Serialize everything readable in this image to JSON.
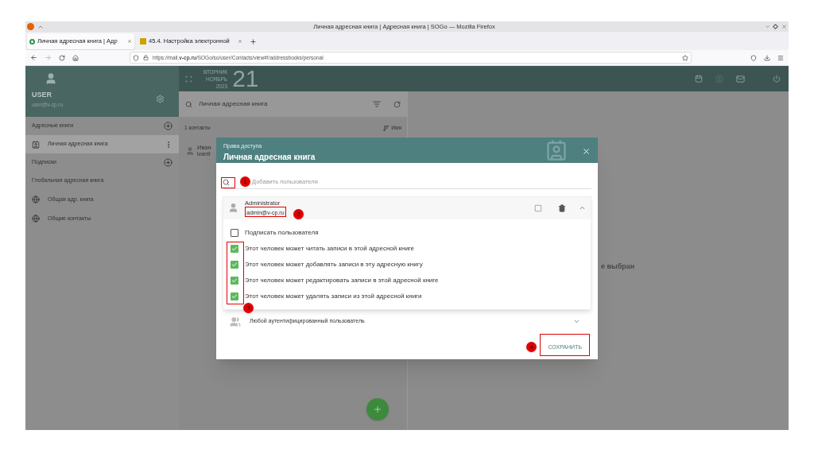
{
  "browser": {
    "title": "Личная адресная книга | Адресная книга | SOGo — Mozilla Firefox",
    "tabs": [
      {
        "label": "Личная адресная книга | Адр",
        "selected": true
      },
      {
        "label": "45.4. Настройка электронной",
        "selected": false
      }
    ],
    "url": "https://mail.**v-cp.ru**/SOGo/so/user/Contacts/view#!/addressbooks/personal"
  },
  "user": {
    "name": "USER",
    "email": "user@v-cp.ru"
  },
  "date": {
    "weekday": "ВТОРНИК",
    "month": "НОЯБРЬ",
    "year": "2023",
    "day": "21"
  },
  "sidebar": [
    {
      "kind": "header",
      "label": "Адресные книги",
      "addable": true
    },
    {
      "kind": "book",
      "label": "Личная адресная книга",
      "selected": true
    },
    {
      "kind": "header",
      "label": "Подписки",
      "addable": true
    },
    {
      "kind": "header",
      "label": "Глобальная адресная книга",
      "addable": false
    },
    {
      "kind": "global",
      "label": "Общая адр. книга",
      "selected": false
    },
    {
      "kind": "global",
      "label": "Общие контакты",
      "selected": false
    }
  ],
  "list": {
    "title": "Личная адресная книга",
    "count": "1 контакты",
    "sort": "Имя",
    "contacts": [
      {
        "name": "Иван",
        "email": "ivan9"
      }
    ]
  },
  "empty_text": "е выбран",
  "dialog": {
    "subtitle": "Права доступа",
    "title": "Личная адресная книга",
    "search_placeholder": "Добавить пользователя",
    "users": [
      {
        "name": "Administrator",
        "email": "admin@v-cp.ru",
        "expanded": true,
        "permissions": [
          {
            "label": "Подписать пользователя",
            "checked": false
          },
          {
            "label": "Этот человек может читать записи в этой адресной книге",
            "checked": true
          },
          {
            "label": "Этот человек может добавлять записи в эту адресную книгу",
            "checked": true
          },
          {
            "label": "Этот человек может редактировать записи в этой адресной книге",
            "checked": true
          },
          {
            "label": "Этот человек может удалять записи из этой адресной книги",
            "checked": true
          }
        ]
      }
    ],
    "any_user": {
      "label": "Любой аутентифицированный пользователь",
      "expanded": false
    },
    "save": "СОХРАНИТЬ"
  },
  "annotations": [
    "1",
    "2",
    "3",
    "4"
  ]
}
